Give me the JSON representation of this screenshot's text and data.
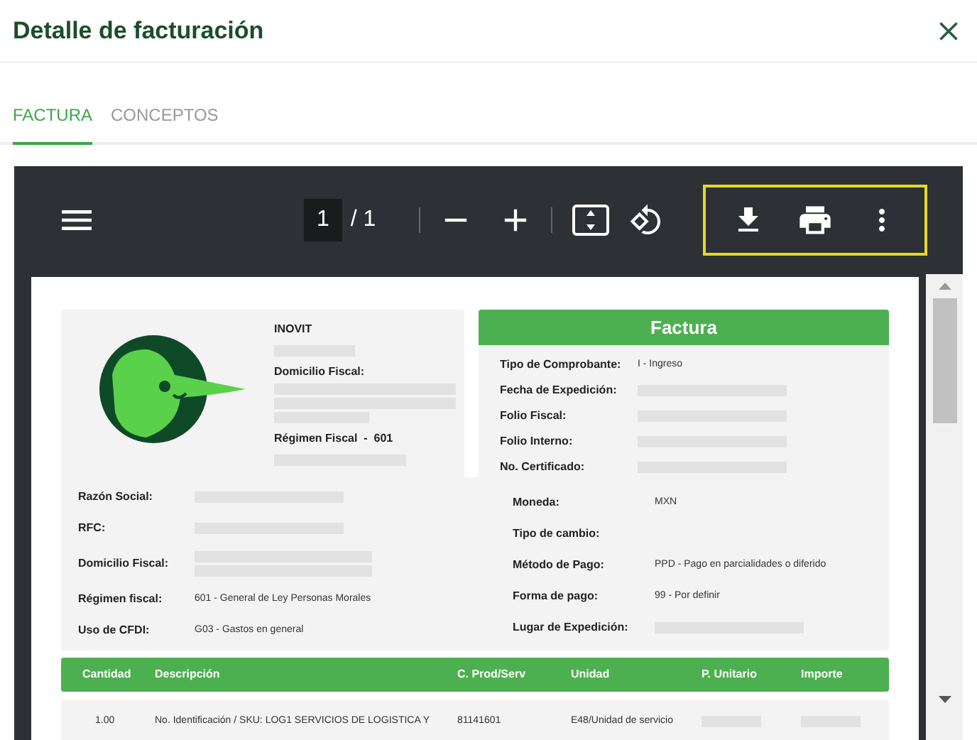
{
  "title": "Detalle de facturación",
  "tabs": [
    {
      "label": "FACTURA",
      "selected": true
    },
    {
      "label": "CONCEPTOS",
      "selected": false
    }
  ],
  "viewer": {
    "page_current": "1",
    "page_total": "/ 1",
    "actions_highlighted": true
  },
  "issuer": {
    "name": "INOVIT",
    "address_label": "Domicilio Fiscal:",
    "regime_label": "Régimen Fiscal  -  601"
  },
  "invoice_title": "Factura",
  "invoice_fields": [
    {
      "label": "Tipo de Comprobante:",
      "kind": "text",
      "value": "I - Ingreso"
    },
    {
      "label": "Fecha de Expedición:",
      "kind": "redacted"
    },
    {
      "label": "Folio Fiscal:",
      "kind": "redacted"
    },
    {
      "label": "Folio Interno:",
      "kind": "redacted"
    },
    {
      "label": "No. Certificado:",
      "kind": "redacted"
    }
  ],
  "customer_fields": [
    {
      "label": "Razón Social:",
      "kind": "redacted"
    },
    {
      "label": "RFC:",
      "kind": "redacted"
    },
    {
      "label": "Domicilio Fiscal:",
      "kind": "redacted-multi"
    },
    {
      "label": "Régimen fiscal:",
      "kind": "text",
      "value": "601 - General de Ley Personas Morales"
    },
    {
      "label": "Uso de CFDI:",
      "kind": "text",
      "value": "G03 - Gastos en general"
    }
  ],
  "payment_fields": [
    {
      "label": "Moneda:",
      "kind": "text",
      "value": "MXN"
    },
    {
      "label": "Tipo de cambio:",
      "kind": "empty"
    },
    {
      "label": "Método de Pago:",
      "kind": "text",
      "value": "PPD - Pago en parcialidades o diferido"
    },
    {
      "label": "Forma de pago:",
      "kind": "text",
      "value": "99 - Por definir"
    },
    {
      "label": "Lugar de Expedición:",
      "kind": "redacted"
    }
  ],
  "table": {
    "columns": [
      "Cantidad",
      "Descripción",
      "C. Prod/Serv",
      "Unidad",
      "P. Unitario",
      "Importe"
    ],
    "rows": [
      {
        "cells": [
          {
            "kind": "text",
            "text": "1.00"
          },
          {
            "kind": "text",
            "text": "No. Identificación / SKU: LOG1 SERVICIOS DE LOGISTICA Y"
          },
          {
            "kind": "text",
            "text": "81141601"
          },
          {
            "kind": "text",
            "text": "E48/Unidad de servicio"
          },
          {
            "kind": "redacted"
          },
          {
            "kind": "redacted"
          }
        ]
      }
    ]
  }
}
